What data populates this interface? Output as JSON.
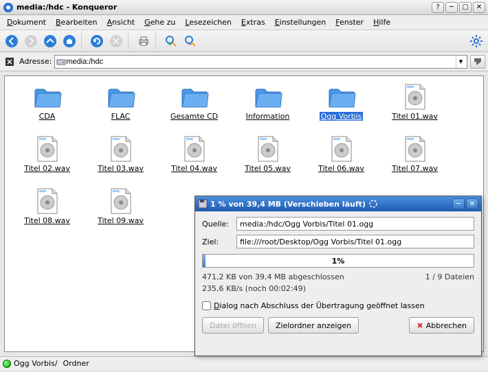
{
  "window": {
    "title": "media:/hdc - Konqueror"
  },
  "menu": {
    "items": [
      {
        "label": "Dokument",
        "m": 0
      },
      {
        "label": "Bearbeiten",
        "m": 0
      },
      {
        "label": "Ansicht",
        "m": 0
      },
      {
        "label": "Gehe zu",
        "m": 0
      },
      {
        "label": "Lesezeichen",
        "m": 0
      },
      {
        "label": "Extras",
        "m": 0
      },
      {
        "label": "Einstellungen",
        "m": 0
      },
      {
        "label": "Fenster",
        "m": 0
      },
      {
        "label": "Hilfe",
        "m": 0
      }
    ]
  },
  "address": {
    "label": "Adresse:",
    "value": "media:/hdc"
  },
  "files": [
    {
      "name": "CDA",
      "type": "folder"
    },
    {
      "name": "FLAC",
      "type": "folder"
    },
    {
      "name": "Gesamte CD",
      "type": "folder"
    },
    {
      "name": "Information",
      "type": "folder"
    },
    {
      "name": "Ogg Vorbis",
      "type": "folder",
      "selected": true
    },
    {
      "name": "Titel 01.wav",
      "type": "audio"
    },
    {
      "name": "Titel 02.wav",
      "type": "audio"
    },
    {
      "name": "Titel 03.wav",
      "type": "audio"
    },
    {
      "name": "Titel 04.wav",
      "type": "audio"
    },
    {
      "name": "Titel 05.wav",
      "type": "audio"
    },
    {
      "name": "Titel 06.wav",
      "type": "audio"
    },
    {
      "name": "Titel 07.wav",
      "type": "audio"
    },
    {
      "name": "Titel 08.wav",
      "type": "audio"
    },
    {
      "name": "Titel 09.wav",
      "type": "audio"
    }
  ],
  "status": {
    "path": "Ogg Vorbis/",
    "kind": "Ordner"
  },
  "dialog": {
    "title": "1 % von 39,4 MB  (Verschieben läuft)",
    "source_label": "Quelle:",
    "source": "media:/hdc/Ogg Vorbis/Titel 01.ogg",
    "dest_label": "Ziel:",
    "dest": "file:///root/Desktop/Ogg Vorbis/Titel 01.ogg",
    "percent": "1%",
    "stats1": "471,2 KB von 39,4 MB abgeschlossen",
    "files_count": "1 / 9 Dateien",
    "stats2": "235,6 KB/s (noch 00:02:49)",
    "keep_open": "Dialog nach Abschluss der Übertragung geöffnet lassen",
    "btn_open": "Datei öffnen",
    "btn_folder": "Zielordner anzeigen",
    "btn_cancel": "Abbrechen"
  }
}
